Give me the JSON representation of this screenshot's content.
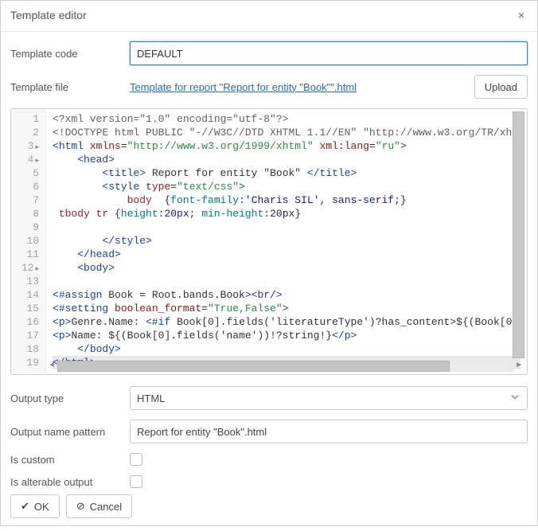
{
  "title": "Template editor",
  "fields": {
    "template_code": {
      "label": "Template code",
      "value": "DEFAULT"
    },
    "template_file": {
      "label": "Template file",
      "link": "Template for report \"Report for entity \"Book\"\".html",
      "upload_label": "Upload"
    },
    "output_type": {
      "label": "Output type",
      "value": "HTML"
    },
    "output_name_pattern": {
      "label": "Output name pattern",
      "value": "Report for entity \"Book\".html"
    },
    "is_custom": {
      "label": "Is custom"
    },
    "is_alterable_output": {
      "label": "Is alterable output"
    }
  },
  "buttons": {
    "ok": "OK",
    "cancel": "Cancel"
  },
  "code": {
    "line_count": 19,
    "fold_lines": [
      3,
      4,
      12
    ],
    "content_plain": "<?xml version=\"1.0\" encoding=\"utf-8\"?>\n<!DOCTYPE html PUBLIC \"-//W3C//DTD XHTML 1.1//EN\" \"http://www.w3.org/TR/xh\n<html xmlns=\"http://www.w3.org/1999/xhtml\" xml:lang=\"ru\">\n    <head>\n        <title> Report for entity \"Book\" </title>\n        <style type=\"text/css\">\n            body  {font-family: 'Charis SIL', sans-serif;}\n tbody tr {height:20px; min-height:20px}\n\n        </style>\n    </head>\n    <body>\n\n<#assign Book = Root.bands.Book><br/>\n<#setting boolean_format=\"True,False\">\n<p>Genre.Name: <#if Book[0].fields('literatureType')?has_content>${(Book[0\n<p>Name: ${(Book[0].fields('name'))!?string!}</p>\n    </body>\n</html>"
  }
}
